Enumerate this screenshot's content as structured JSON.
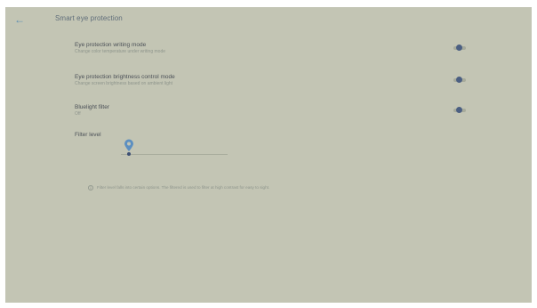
{
  "header": {
    "back_glyph": "←",
    "title": "Smart eye protection"
  },
  "settings": [
    {
      "title": "Eye protection writing mode",
      "subtitle": "Change color temperature under writing mode",
      "toggle_on": true
    },
    {
      "title": "Eye protection brightness control mode",
      "subtitle": "Change screen brightness based on ambient light",
      "toggle_on": true
    },
    {
      "title": "Bluelight filter",
      "subtitle": "Off",
      "toggle_on": true
    }
  ],
  "filter": {
    "label": "Filter level",
    "level_fraction": 0.08
  },
  "info": {
    "text": "Filter level falls into certain options. The filtered is used to filter at high contrast for easy to sight."
  },
  "colors": {
    "screen_bg": "#c3c5b4",
    "accent": "#4b5f82",
    "pin": "#5c8fc1"
  }
}
